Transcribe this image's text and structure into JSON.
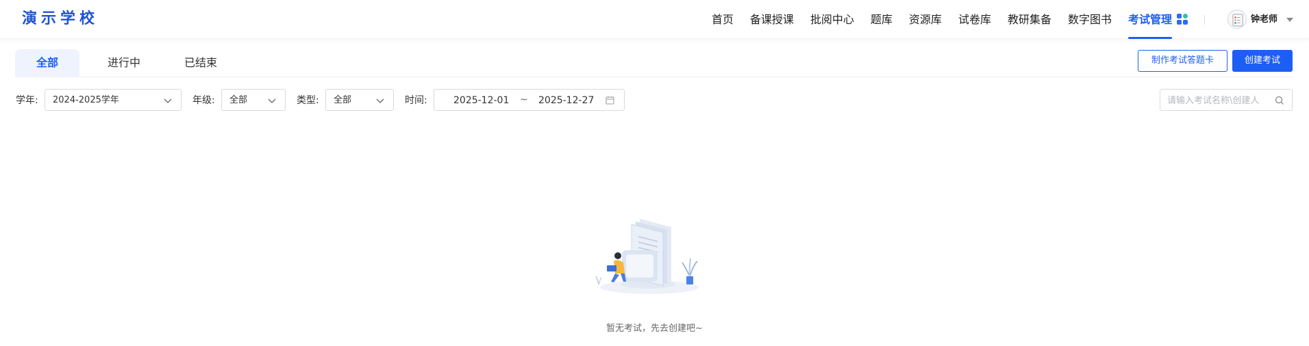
{
  "header": {
    "logo": "演示学校",
    "nav": [
      {
        "label": "首页",
        "active": false
      },
      {
        "label": "备课授课",
        "active": false
      },
      {
        "label": "批阅中心",
        "active": false
      },
      {
        "label": "题库",
        "active": false
      },
      {
        "label": "资源库",
        "active": false
      },
      {
        "label": "试卷库",
        "active": false
      },
      {
        "label": "教研集备",
        "active": false
      },
      {
        "label": "数字图书",
        "active": false
      },
      {
        "label": "考试管理",
        "active": true
      }
    ],
    "apps_icon": "apps-grid-icon",
    "user": {
      "name": "钟老师",
      "avatar_icon": "avatar-icon",
      "caret_icon": "caret-down-icon"
    }
  },
  "tabs": [
    {
      "label": "全部",
      "active": true
    },
    {
      "label": "进行中",
      "active": false
    },
    {
      "label": "已结束",
      "active": false
    }
  ],
  "actions": {
    "answer_card_label": "制作考试答题卡",
    "create_exam_label": "创建考试"
  },
  "filters": {
    "year_label": "学年:",
    "year_value": "2024-2025学年",
    "grade_label": "年级:",
    "grade_value": "全部",
    "type_label": "类型:",
    "type_value": "全部",
    "time_label": "时间:",
    "date_start": "2025-12-01",
    "date_sep": "~",
    "date_end": "2025-12-27",
    "search_placeholder": "请输入考试名称\\创建人"
  },
  "empty": {
    "text": "暂无考试，先去创建吧~",
    "illustration": "empty-exam-illustration"
  },
  "colors": {
    "primary": "#1d5ef5",
    "logo": "#1f53d6",
    "tab_active_bg": "#eef3fd"
  }
}
